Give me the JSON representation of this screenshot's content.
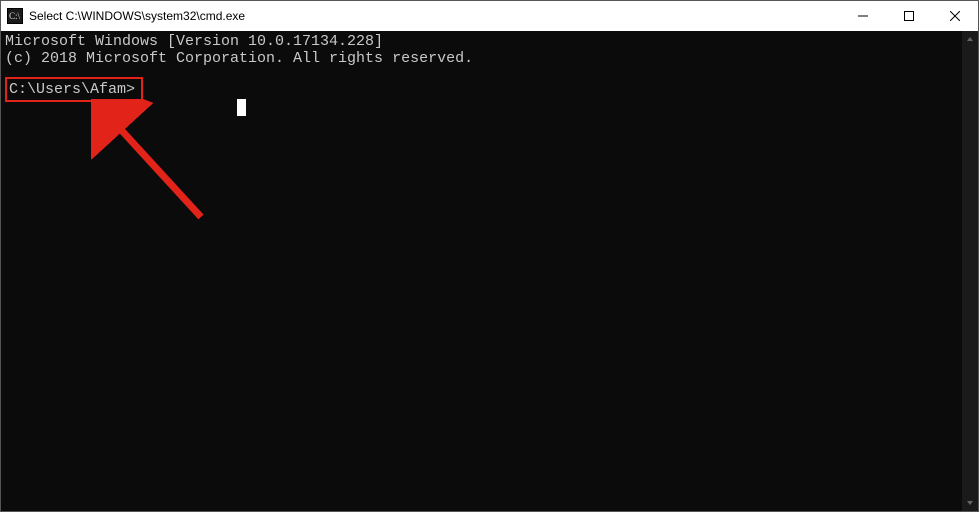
{
  "titlebar": {
    "title": "Select C:\\WINDOWS\\system32\\cmd.exe"
  },
  "console": {
    "line1": "Microsoft Windows [Version 10.0.17134.228]",
    "line2": "(c) 2018 Microsoft Corporation. All rights reserved.",
    "prompt": "C:\\Users\\Afam>"
  },
  "annotation": {
    "highlight_color": "#e2231a"
  }
}
